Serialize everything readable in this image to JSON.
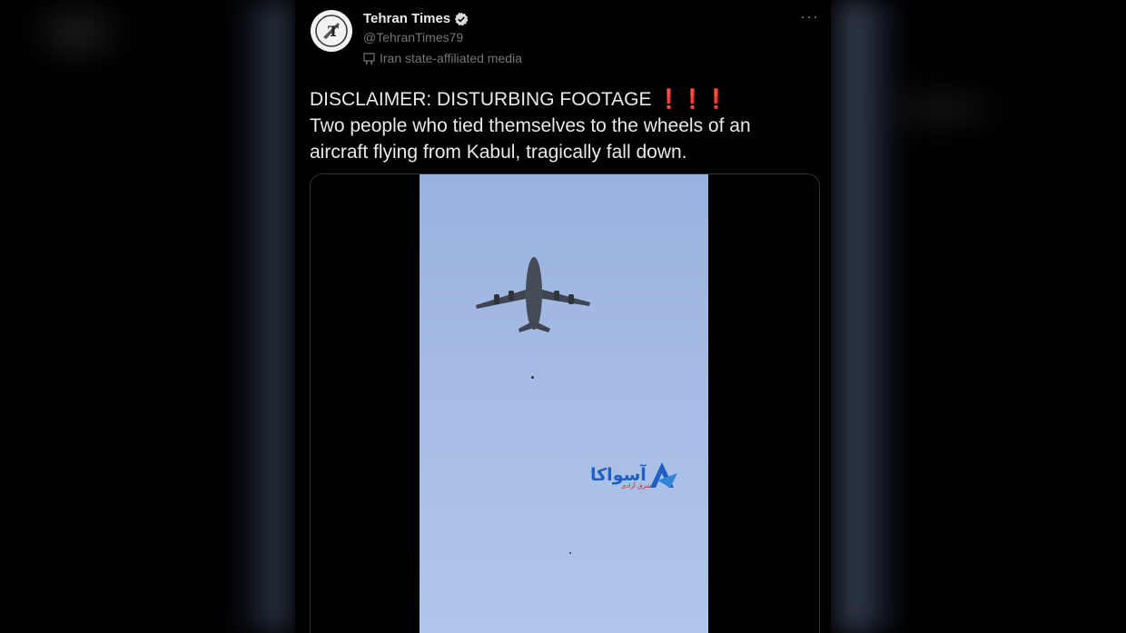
{
  "account": {
    "name": "Tehran Times",
    "handle": "@TehranTimes79",
    "affiliation": "Iran state-affiliated media",
    "avatar_icon": "tehran-times-logo-icon",
    "verified_icon": "verified-badge-icon"
  },
  "menu": {
    "more_label": "···"
  },
  "tweet": {
    "line1": "DISCLAIMER: DISTURBING FOOTAGE",
    "emphasis": "❗❗❗",
    "line2": "Two people who tied themselves to the wheels of an",
    "line3": "aircraft flying from Kabul, tragically fall down."
  },
  "media": {
    "watermark_text": "آسواکا",
    "watermark_sub": "شرق آزادی",
    "colors": {
      "sky": "#a6bce5",
      "watermark": "#1f5fc4",
      "emphasis": "#e0242a"
    }
  }
}
